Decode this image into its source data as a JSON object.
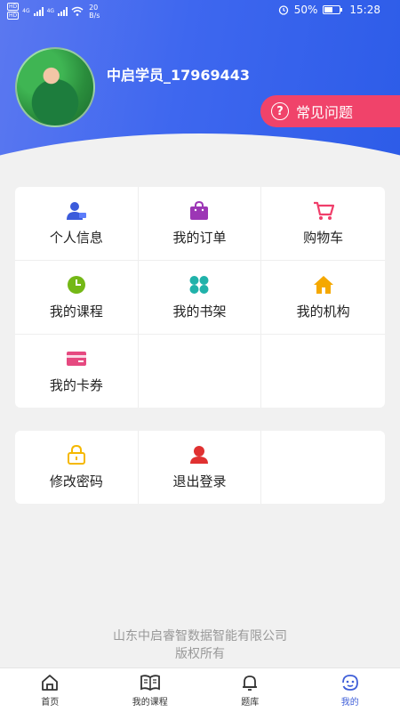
{
  "status_bar": {
    "hd1": "HD",
    "hd2": "HD",
    "net1": "4G",
    "net2": "4G",
    "speed_value": "20",
    "speed_unit": "B/s",
    "battery": "50%",
    "time": "15:28"
  },
  "profile": {
    "username": "中启学员_17969443",
    "faq_icon": "?",
    "faq_label": "常见问题"
  },
  "menu_main": [
    {
      "label": "个人信息",
      "icon": "person-card-icon",
      "color": "#3b5bdb"
    },
    {
      "label": "我的订单",
      "icon": "shopping-bag-icon",
      "color": "#9c36b5"
    },
    {
      "label": "购物车",
      "icon": "cart-icon",
      "color": "#f03e6a"
    },
    {
      "label": "我的课程",
      "icon": "clock-icon",
      "color": "#74b816"
    },
    {
      "label": "我的书架",
      "icon": "grid-circles-icon",
      "color": "#20b2aa"
    },
    {
      "label": "我的机构",
      "icon": "house-icon",
      "color": "#f5a800"
    },
    {
      "label": "我的卡券",
      "icon": "card-coupon-icon",
      "color": "#e64980"
    }
  ],
  "menu_account": [
    {
      "label": "修改密码",
      "icon": "lock-icon",
      "color": "#f5b800"
    },
    {
      "label": "退出登录",
      "icon": "user-logout-icon",
      "color": "#e03131"
    }
  ],
  "footer": {
    "line1": "山东中启睿智数据智能有限公司",
    "line2": "版权所有"
  },
  "bottom_nav": [
    {
      "label": "首页",
      "icon": "home-icon",
      "active": false
    },
    {
      "label": "我的课程",
      "icon": "book-icon",
      "active": false
    },
    {
      "label": "题库",
      "icon": "bell-icon",
      "active": false
    },
    {
      "label": "我的",
      "icon": "smiley-icon",
      "active": true
    }
  ]
}
